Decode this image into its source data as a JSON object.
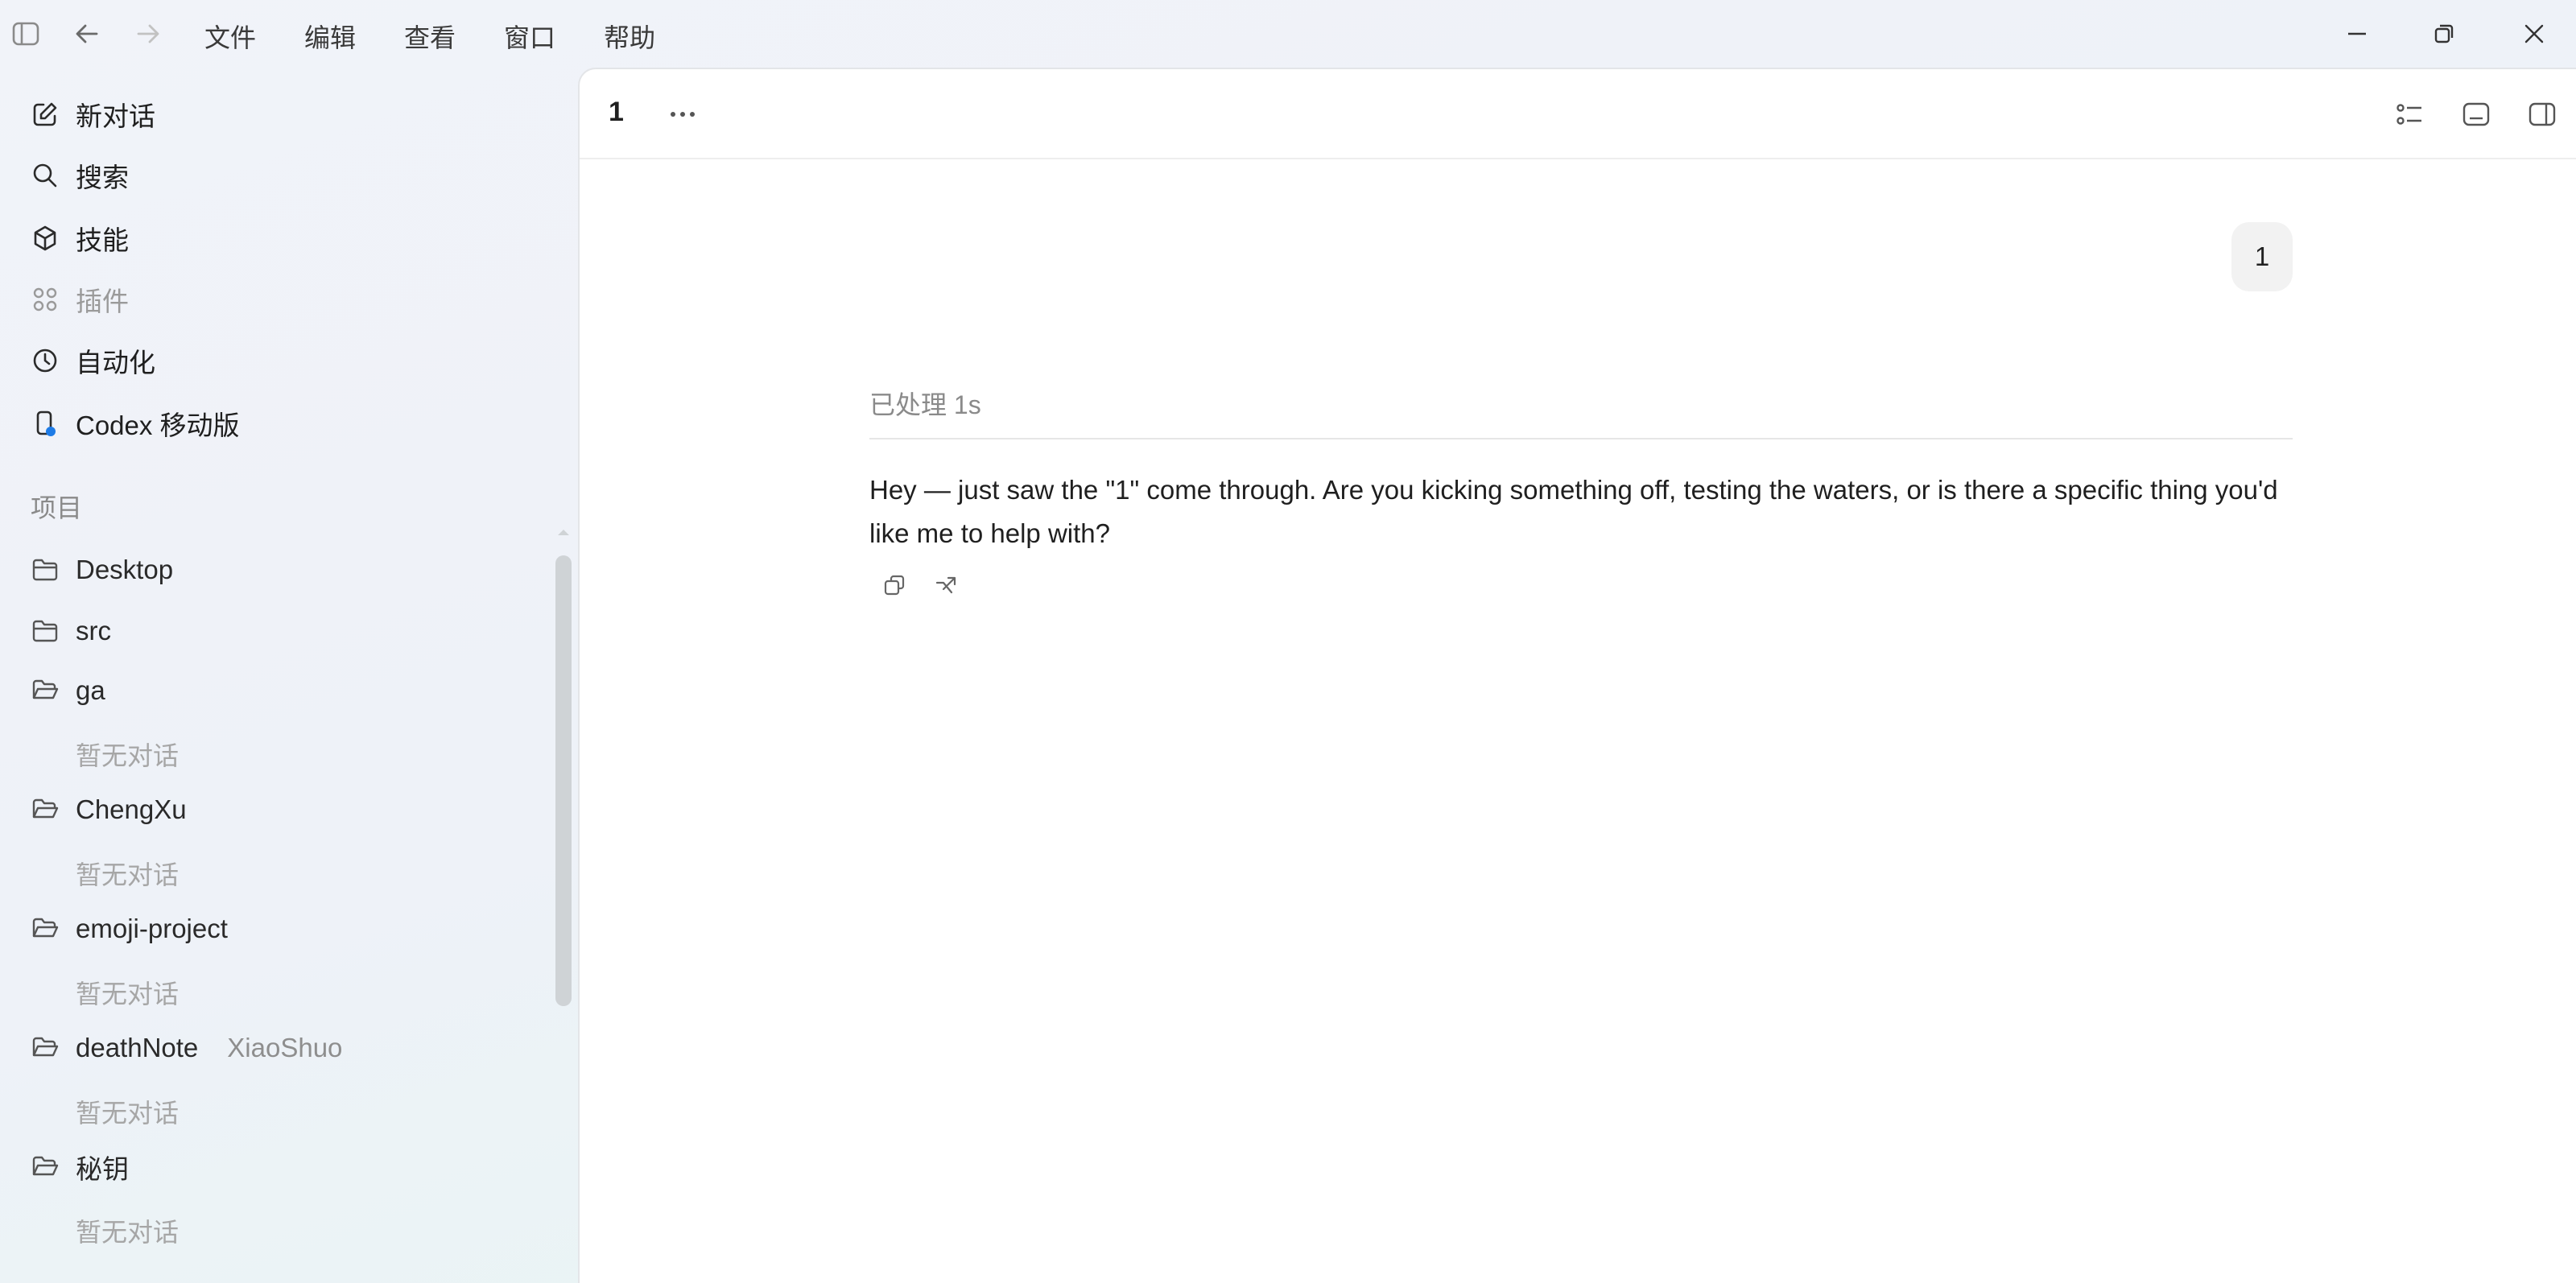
{
  "menu": {
    "items": [
      "文件",
      "编辑",
      "查看",
      "窗口",
      "帮助"
    ]
  },
  "sidebar": {
    "nav": [
      {
        "label": "新对话",
        "icon": "edit-icon"
      },
      {
        "label": "搜索",
        "icon": "search-icon"
      },
      {
        "label": "技能",
        "icon": "cube-icon"
      },
      {
        "label": "插件",
        "icon": "grid-icon"
      },
      {
        "label": "自动化",
        "icon": "clock-icon"
      },
      {
        "label": "Codex 移动版",
        "icon": "mobile-icon"
      }
    ],
    "projects_label": "项目",
    "empty_label": "暂无对话",
    "projects": [
      {
        "name": "Desktop"
      },
      {
        "name": "src"
      },
      {
        "name": "ga"
      },
      {
        "name": "ChengXu"
      },
      {
        "name": "emoji-project"
      },
      {
        "name": "deathNote",
        "tag": "XiaoShuo"
      },
      {
        "name": "秘钥"
      }
    ]
  },
  "conversation": {
    "title": "1",
    "user_message": "1",
    "processed_text": "已处理 1s",
    "reply": "Hey — just saw the \"1\" come through. Are you kicking something off, testing the waters, or is there a specific thing you'd like me to help with?"
  },
  "colors": {
    "accent_dot": "#1e7be6",
    "bubble": "#f2f2f2"
  }
}
